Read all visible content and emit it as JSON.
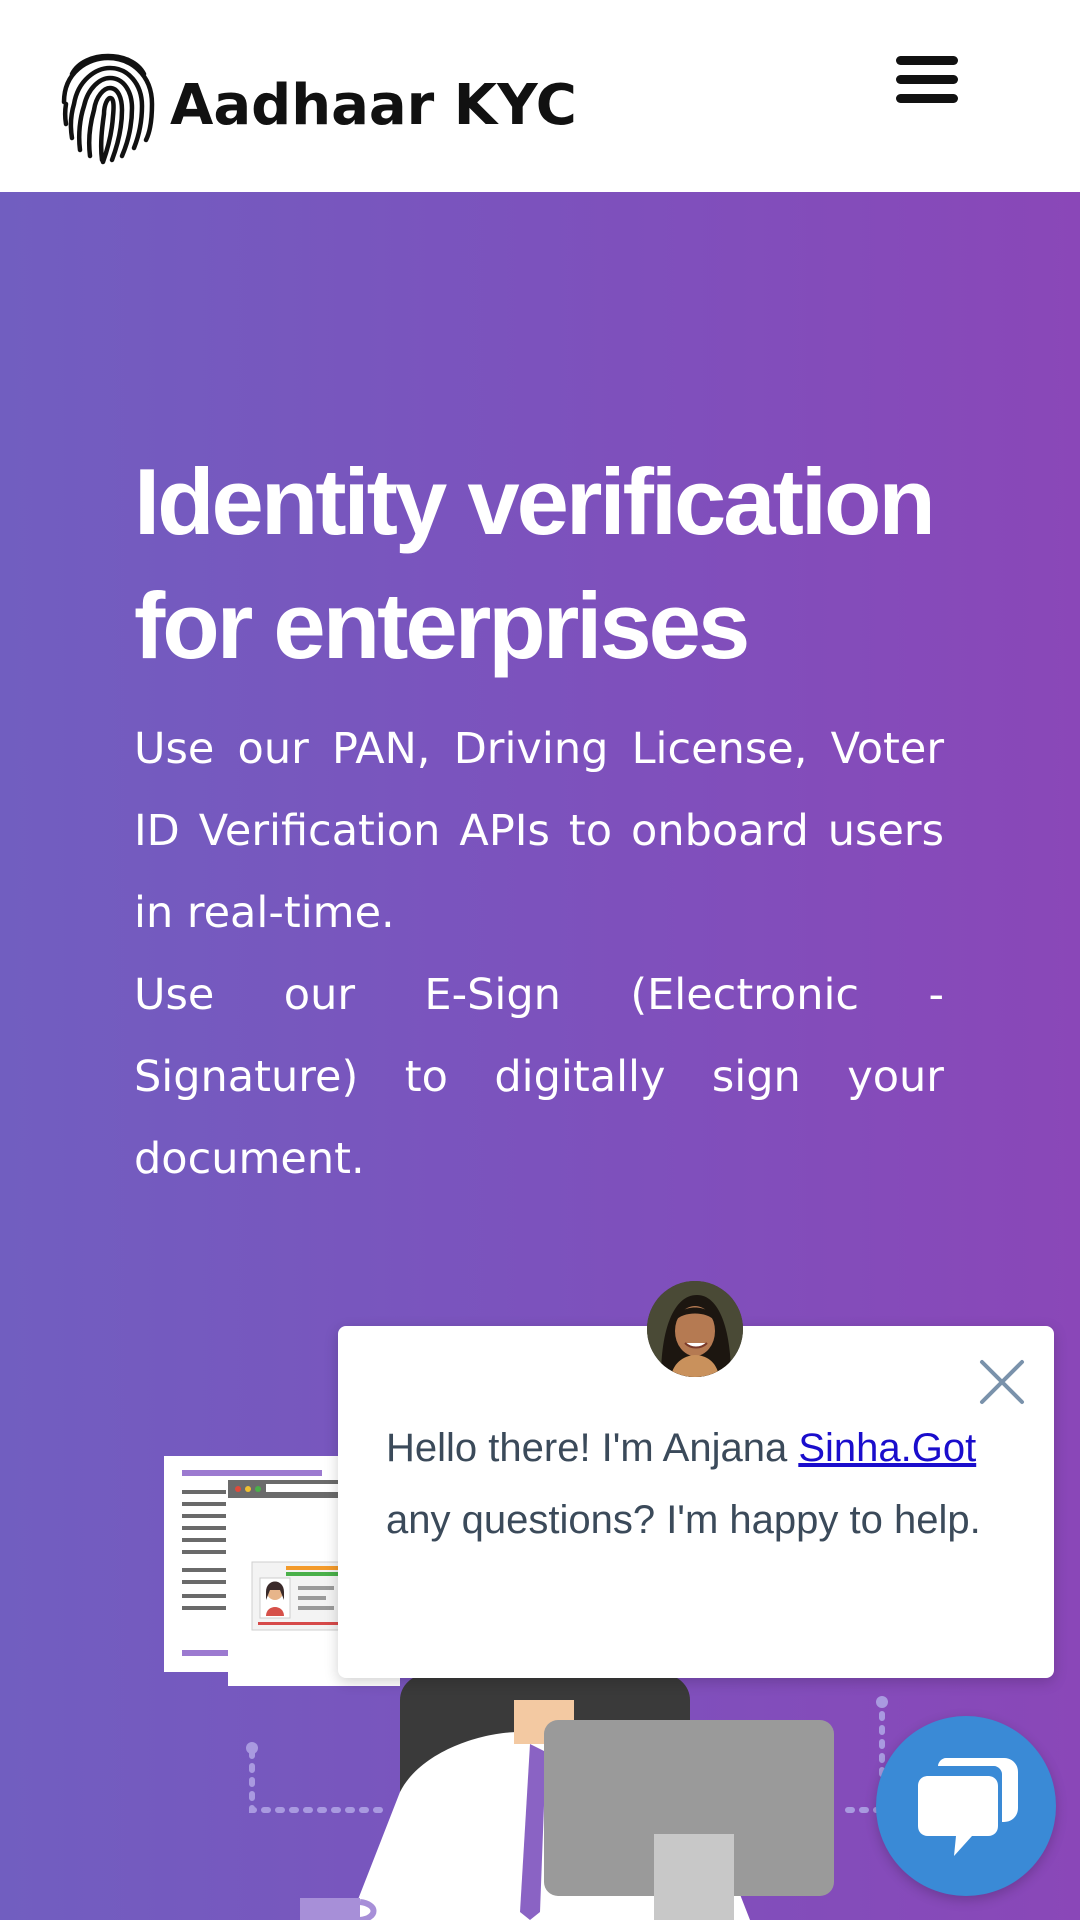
{
  "header": {
    "brand": "Aadhaar KYC",
    "logo_icon": "fingerprint-icon",
    "menu_icon": "hamburger-menu-icon"
  },
  "hero": {
    "title": "Identity verification for enterprises",
    "paragraph_1": "Use our PAN, Driving License, Voter ID Verification APIs to onboard users in real-time.",
    "paragraph_2": "Use our E-Sign (Electronic -Signature) to digitally sign your document.",
    "colors": {
      "gradient_start": "#715ec0",
      "gradient_end": "#8a47b8"
    }
  },
  "chat": {
    "message_start": "Hello there! I'm Anjana ",
    "message_link": "Sinha.Got",
    "message_end": " any questions? I'm happy to help.",
    "close_icon": "close-icon",
    "launcher_icon": "chat-bubble-icon",
    "launcher_color": "#3a8ad6"
  }
}
